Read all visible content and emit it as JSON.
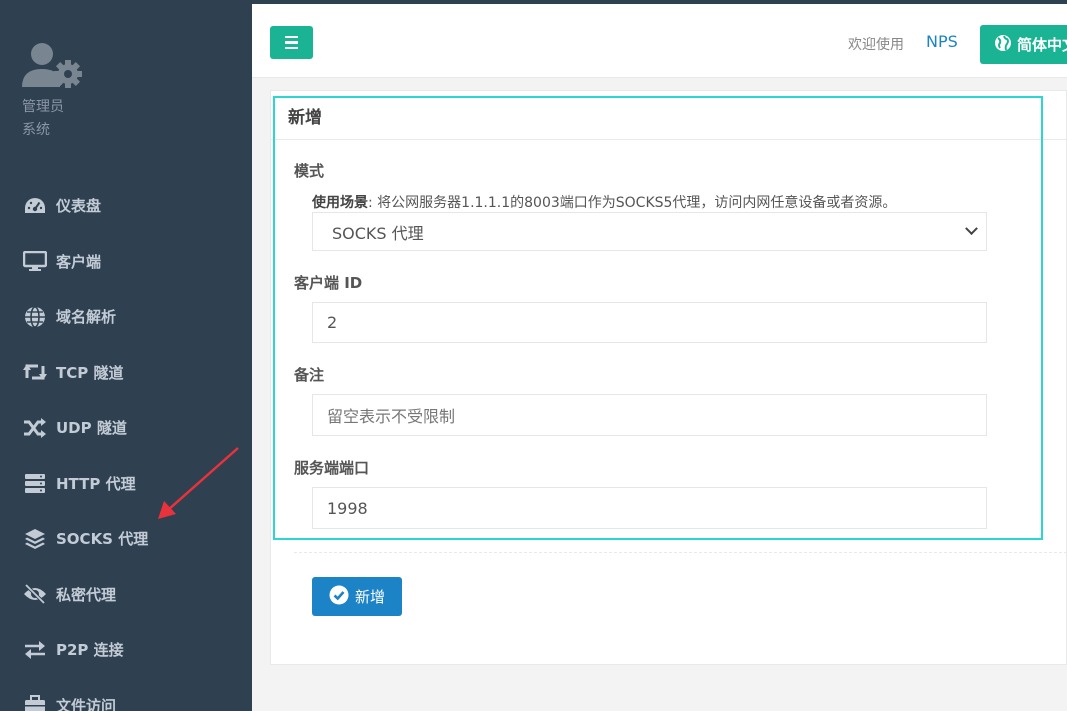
{
  "sidebar": {
    "profile": {
      "name": "管理员",
      "role": "系统"
    },
    "items": [
      {
        "label": "仪表盘",
        "icon": "dashboard-icon"
      },
      {
        "label": "客户端",
        "icon": "desktop-icon"
      },
      {
        "label": "域名解析",
        "icon": "globe-icon"
      },
      {
        "label": "TCP 隧道",
        "icon": "retweet-icon"
      },
      {
        "label": "UDP 隧道",
        "icon": "shuffle-icon"
      },
      {
        "label": "HTTP 代理",
        "icon": "server-icon"
      },
      {
        "label": "SOCKS 代理",
        "icon": "layers-icon"
      },
      {
        "label": "私密代理",
        "icon": "eye-slash-icon"
      },
      {
        "label": "P2P 连接",
        "icon": "exchange-icon"
      },
      {
        "label": "文件访问",
        "icon": "briefcase-icon"
      }
    ]
  },
  "header": {
    "welcome": "欢迎使用",
    "brand": "NPS",
    "language_label": "简体中文"
  },
  "form": {
    "title": "新增",
    "mode_label": "模式",
    "hint_bold": "使用场景",
    "hint_text": ": 将公网服务器1.1.1.1的8003端口作为SOCKS5代理，访问内网任意设备或者资源。",
    "mode_value": "SOCKS 代理",
    "client_id_label": "客户端 ID",
    "client_id_value": "2",
    "remark_label": "备注",
    "remark_placeholder": "留空表示不受限制",
    "port_label": "服务端端口",
    "port_value": "1998",
    "submit_label": "新增"
  },
  "colors": {
    "sidebar_bg": "#2f4050",
    "primary": "#1ab394",
    "button_blue": "#1c84c6",
    "highlight": "#2cd6d3",
    "annotation_arrow": "#e8323c"
  }
}
